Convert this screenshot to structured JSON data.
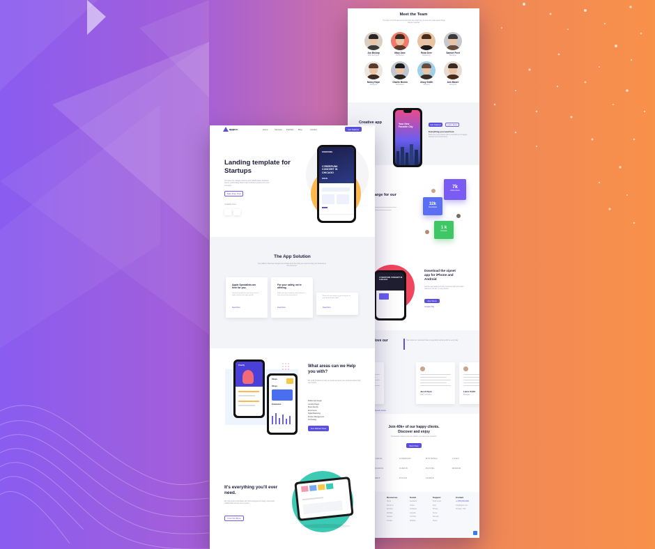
{
  "colors": {
    "accent": "#5b4fe0",
    "bg_left": "#8a5cf0",
    "bg_right": "#f8914a",
    "teal": "#3ccab4",
    "coral": "#f2455e",
    "green": "#3fc766"
  },
  "front": {
    "nav": {
      "logo": "appco.",
      "items": [
        "Home",
        "Services",
        "Portfolio",
        "Blog",
        "Contact"
      ],
      "cta": "Get Started"
    },
    "hero": {
      "title": "Landing template for Startups",
      "body": "Increase the release velocity and collaboration between teams, and build a brand new business process for your company.",
      "button": "Start Free Trial",
      "note": "Available Now",
      "phone": {
        "label": "DOWNTOWN",
        "headline": "CYBERPUNK CONCERT IN CHICAGO",
        "price": "$49.99"
      }
    },
    "solution": {
      "title": "The App Solution",
      "body": "Our platform has been designed to provide all of the tools you need to bring your business to the next level.",
      "cards": [
        {
          "title": "Apple Specialists are here for you.",
          "body": "Give your people the tools they need to build sophisticated apps quickly.",
          "link": "Read More"
        },
        {
          "title": "For your safety, we're offering.",
          "body": "Make sure your hardware and software is kept secure from every threat.",
          "link": "Read More"
        },
        {
          "title": "",
          "body": "Work with our experts to get every part of your product done right.",
          "link": "Read More"
        }
      ]
    },
    "areas": {
      "title": "What areas can we Help you with?",
      "body": "We build products to help you scale and grow your business faster than ever before.",
      "list": [
        "Mobile App Design",
        "Landing Pages",
        "Brand Identity",
        "Ecommerce",
        "Digital Marketing",
        "Product Management",
        "Technology"
      ],
      "button": "Get Started Now",
      "phone1": {
        "title": "Pixelify"
      },
      "phone2": {
        "title": "Shops",
        "tag": "Shops",
        "subtitle": "Endurance"
      }
    },
    "everything": {
      "title": "It's everything you'll ever need.",
      "body": "We help teams build faster with tools designed for clarity, speed and collaboration across every project.",
      "button": "Find Out More"
    }
  },
  "back": {
    "team": {
      "title": "Meet the Team",
      "body": "Our team is full of talented people who love what they do and who make great things happen together.",
      "members": [
        {
          "name": "Jon Bishop",
          "role": "Web Designer"
        },
        {
          "name": "Mary Jane",
          "role": "Developer"
        },
        {
          "name": "Rosa Deer",
          "role": "Marketing"
        },
        {
          "name": "Samuel Ford",
          "role": "Manager"
        },
        {
          "name": "Nancy Hope",
          "role": "Designer"
        },
        {
          "name": "Charlie Brown",
          "role": "Developer"
        },
        {
          "name": "Jessy Smith",
          "role": "Support"
        },
        {
          "name": "Ann Moore",
          "role": "Designer"
        }
      ]
    },
    "creative": {
      "title": "Creative app",
      "btn1": "Get Started",
      "btn2": "Learn More",
      "sub": "Everything you need here",
      "body": "Build your next product with a complete set of pages, features and components.",
      "phone": {
        "headline": "Your New Favorite City"
      }
    },
    "charge": {
      "title": "We don't charge for our customer",
      "stats": [
        {
          "value": "7k",
          "label": "Active Users"
        },
        {
          "value": "32k",
          "label": "Downloads"
        },
        {
          "value": "1 k",
          "label": "Reviews"
        }
      ]
    },
    "download": {
      "title": "Download the vipnet app for iPhone and Android",
      "body": "Get the app today and stay connected with your team wherever you are, on any device.",
      "btn1": "App Store",
      "btn2": "Google Play",
      "phone": {
        "headline": "CYBERPUNK CONCERT IN CHICAGO"
      }
    },
    "testimonials": {
      "title": "What users love our app.",
      "intro": "Hear what our customers have to say about working with us every day.",
      "cards": [
        {
          "name": "",
          "role": ""
        },
        {
          "name": "Jacob Ryan",
          "role": "CEO, Company"
        },
        {
          "name": "Laura Smith",
          "role": "Manager"
        }
      ],
      "link": "View all reviews"
    },
    "clients": {
      "title": "Join 40k+ of our happy clients. Discover and enjoy",
      "body": "Thousands of teams trust our platform to power their products.",
      "button": "Start Now",
      "logos": [
        "GLOBAL",
        "COMPANY",
        "NATIONAL",
        "LOGO",
        "FINANCE",
        "CHECK",
        "PAYPEL",
        "BRAND",
        "ORBIT",
        "STACK",
        "FORGE"
      ]
    },
    "footer": {
      "cols": [
        {
          "title": "Resources",
          "items": [
            "Home",
            "About Us",
            "Services",
            "Portfolio",
            "Careers",
            "Contact"
          ]
        },
        {
          "title": "Social",
          "items": [
            "Facebook",
            "Twitter",
            "Instagram",
            "LinkedIn",
            "YouTube",
            "Dribbble"
          ]
        },
        {
          "title": "Support",
          "items": [
            "Help Center",
            "FAQ",
            "Privacy",
            "Terms",
            "Sitemap",
            "Status"
          ]
        },
        {
          "title": "Contact",
          "items": [
            "+1 (555) 000-0000",
            "info@appco.com",
            "Chicago, USA"
          ]
        }
      ]
    }
  }
}
